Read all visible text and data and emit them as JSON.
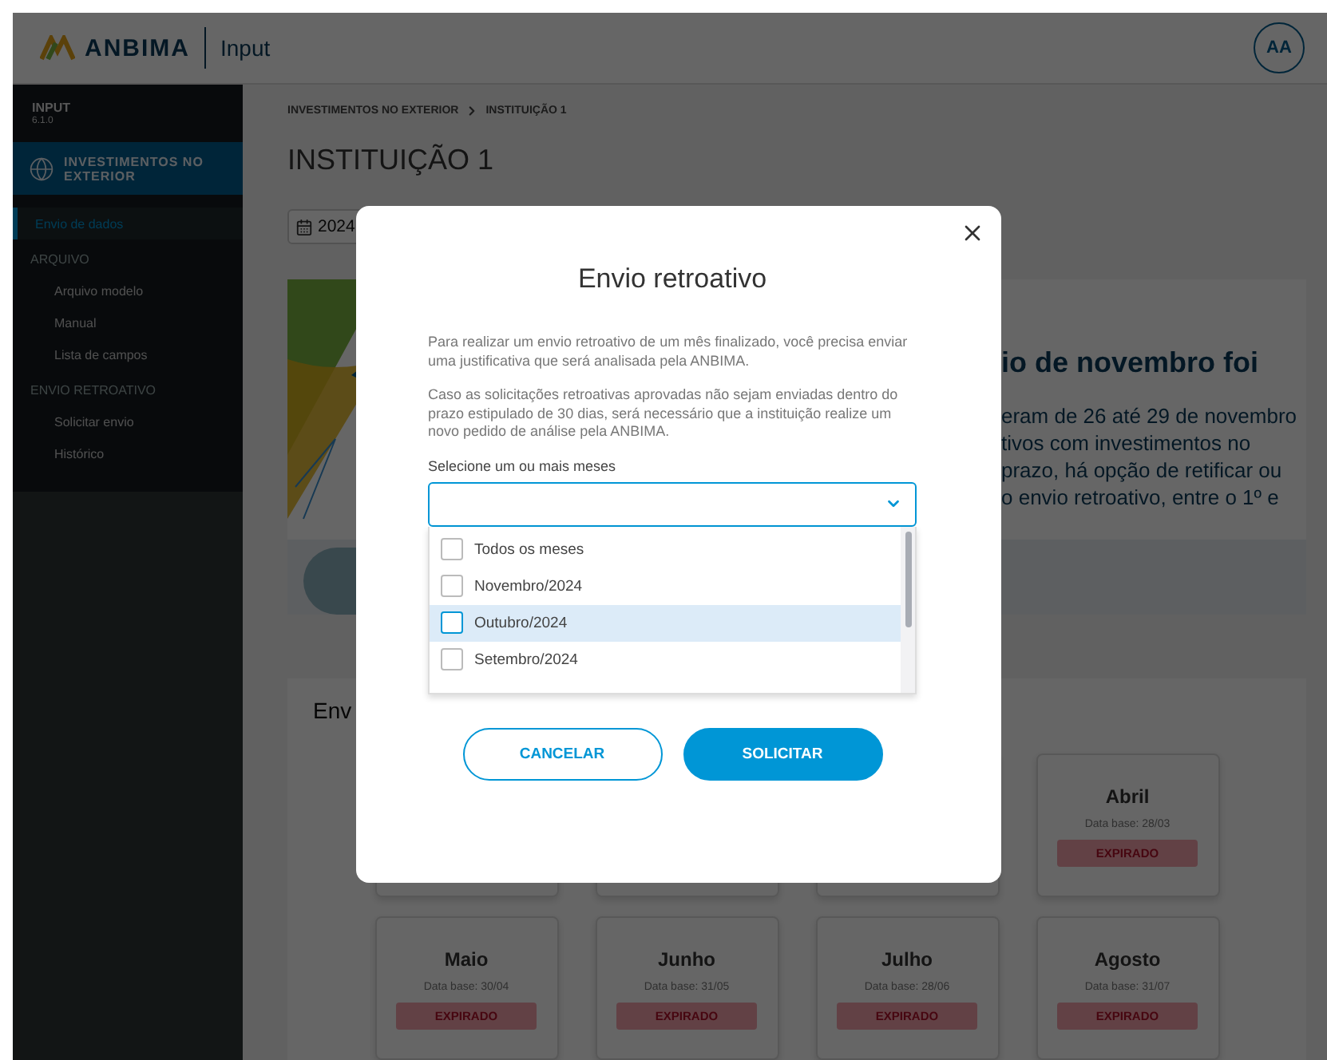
{
  "header": {
    "brand": "ANBIMA",
    "product": "Input",
    "avatar": "AA"
  },
  "sidebar": {
    "app": "INPUT",
    "version": "6.1.0",
    "module": "INVESTIMENTOS NO EXTERIOR",
    "items": [
      {
        "kind": "link",
        "label": "Envio de dados",
        "selected": true
      },
      {
        "kind": "group",
        "label": "ARQUIVO",
        "children": [
          {
            "label": "Arquivo modelo",
            "selected": false
          },
          {
            "label": "Manual",
            "selected": false
          },
          {
            "label": "Lista de campos",
            "selected": false
          }
        ]
      },
      {
        "kind": "group",
        "label": "ENVIO RETROATIVO",
        "children": [
          {
            "label": "Solicitar envio",
            "selected": false
          },
          {
            "label": "Histórico",
            "selected": false
          }
        ]
      }
    ]
  },
  "breadcrumb": [
    "INVESTIMENTOS NO EXTERIOR",
    "INSTITUIÇÃO 1"
  ],
  "page_title": "INSTITUIÇÃO 1",
  "date_filter": {
    "value": "2024"
  },
  "banner": {
    "title": "io de novembro foi",
    "lines": [
      "eram de 26 até 29 de novembro",
      "tivos com investimentos no",
      "prazo, há opção de retificar ou",
      "o envio retroativo, entre o 1º e"
    ]
  },
  "section": {
    "title": "Env",
    "cards": [
      {
        "kind": "covered"
      },
      {
        "kind": "covered"
      },
      {
        "kind": "covered"
      },
      {
        "kind": "month",
        "month": "Abril",
        "date": "Data base: 28/03",
        "status": "EXPIRADO"
      },
      {
        "kind": "month",
        "month": "Maio",
        "date": "Data base: 30/04",
        "status": "EXPIRADO"
      },
      {
        "kind": "month",
        "month": "Junho",
        "date": "Data base: 31/05",
        "status": "EXPIRADO"
      },
      {
        "kind": "month",
        "month": "Julho",
        "date": "Data base: 28/06",
        "status": "EXPIRADO"
      },
      {
        "kind": "month",
        "month": "Agosto",
        "date": "Data base: 31/07",
        "status": "EXPIRADO"
      }
    ]
  },
  "modal": {
    "title": "Envio retroativo",
    "paragraphs": [
      "Para realizar um envio retroativo de um mês finalizado, você precisa enviar uma justificativa que será analisada pela ANBIMA.",
      "Caso as solicitações retroativas aprovadas não sejam enviadas dentro do prazo estipulado de 30 dias, será necessário que a instituição realize um novo pedido de análise pela ANBIMA."
    ],
    "select_label": "Selecione um ou mais meses",
    "expanded": true,
    "options": [
      {
        "label": "Todos os meses",
        "checked": false,
        "highlighted": false
      },
      {
        "label": "Novembro/2024",
        "checked": false,
        "highlighted": false
      },
      {
        "label": "Outubro/2024",
        "checked": false,
        "highlighted": true
      },
      {
        "label": "Setembro/2024",
        "checked": false,
        "highlighted": false
      }
    ],
    "buttons": [
      {
        "kind": "secondary",
        "label": "CANCELAR"
      },
      {
        "kind": "primary",
        "label": "SOLICITAR"
      }
    ]
  }
}
